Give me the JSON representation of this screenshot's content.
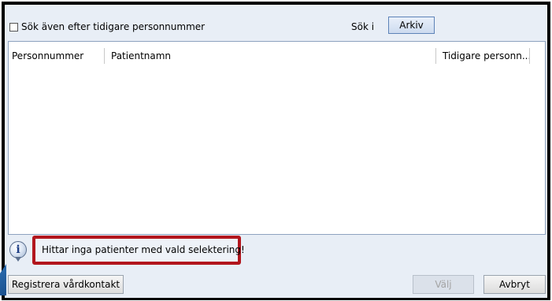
{
  "top_bar": {
    "checkbox_label": "Sök även efter tidigare personnummer",
    "checkbox_checked": false,
    "search_in_label": "Sök i",
    "archive_button_label": "Arkiv"
  },
  "table": {
    "columns": [
      "Personnummer",
      "Patientnamn",
      "Tidigare personn..."
    ],
    "rows": []
  },
  "message": {
    "icon": "info-icon",
    "text": "Hittar inga patienter med vald selektering!",
    "highlight_color": "#b2161d"
  },
  "footer": {
    "register_button_label": "Registrera vårdkontakt",
    "select_button_label": "Välj",
    "select_button_enabled": false,
    "cancel_button_label": "Avbryt"
  }
}
